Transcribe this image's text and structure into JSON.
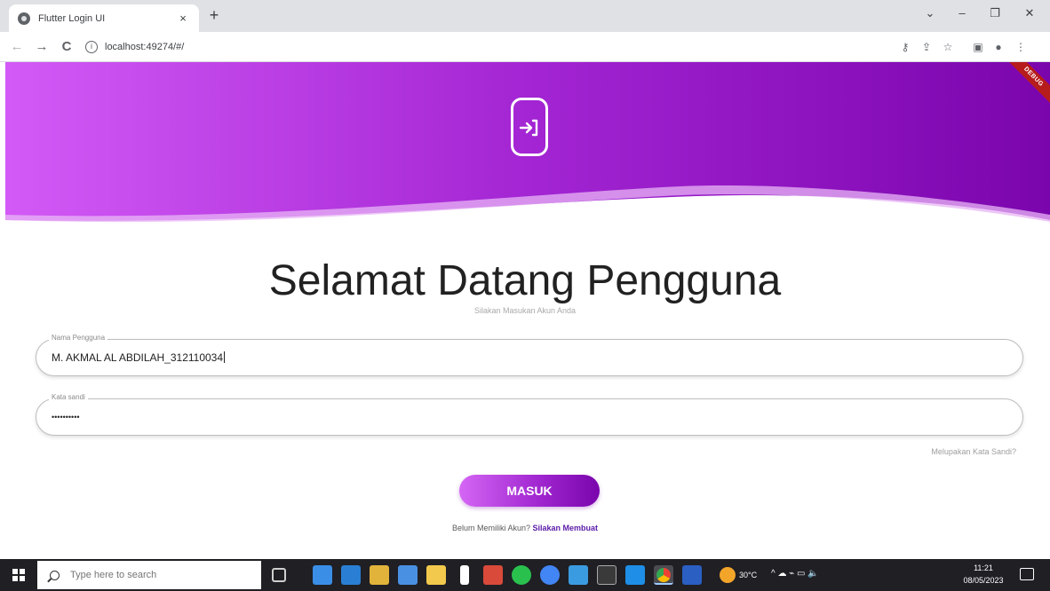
{
  "browser": {
    "tab_title": "Flutter Login UI",
    "tab_close": "×",
    "new_tab": "+",
    "url": "localhost:49274/#/",
    "window_controls": {
      "dropdown": "⌄",
      "minimize": "–",
      "restore": "❐",
      "close": "✕"
    },
    "nav": {
      "back": "←",
      "forward": "→",
      "reload": "C"
    },
    "toolbar_icons": [
      "key-icon",
      "share-icon",
      "star-icon",
      "sidepanel-icon",
      "profile-icon",
      "menu-icon"
    ]
  },
  "page": {
    "debug_banner": "DEBUG",
    "title": "Selamat Datang Pengguna",
    "subtitle": "Silakan Masukan Akun Anda",
    "username": {
      "label": "Nama Pengguna",
      "value": "M. AKMAL AL ABDILAH_312110034"
    },
    "password": {
      "label": "Kata sandi",
      "value": "••••••••••"
    },
    "forgot_password": "Melupakan Kata Sandi?",
    "login_button": "MASUK",
    "signup_prompt": "Belum Memiliki Akun?",
    "signup_link": "Silakan Membuat",
    "colors": {
      "gradient_start": "#d35af6",
      "gradient_end": "#7b05ad",
      "link": "#5a1aa8"
    }
  },
  "taskbar": {
    "search_placeholder": "Type here to search",
    "weather": "30°C",
    "time": "11:21",
    "date": "08/05/2023"
  }
}
